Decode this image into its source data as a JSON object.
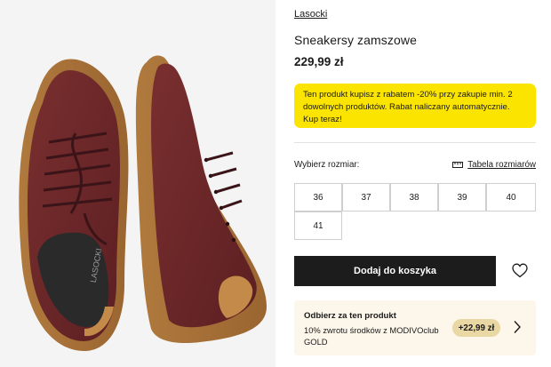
{
  "product": {
    "brand": "Lasocki",
    "name": "Sneakersy zamszowe",
    "price": "229,99 zł",
    "insole_logo": "LASOCKI"
  },
  "promo": {
    "text": "Ten produkt kupisz z rabatem -20% przy zakupie min. 2 dowolnych produktów. Rabat naliczany automatycznie. Kup teraz!",
    "color": "#fbe400"
  },
  "sizes": {
    "label": "Wybierz rozmiar:",
    "table_link": "Tabela rozmiarów",
    "options": [
      "36",
      "37",
      "38",
      "39",
      "40",
      "41"
    ]
  },
  "cart": {
    "add_label": "Dodaj do koszyka"
  },
  "icons": {
    "wishlist": "heart-icon",
    "size_table": "ruler-icon",
    "reward": "chevron-right-icon"
  },
  "reward": {
    "title": "Odbierz za ten produkt",
    "description": "10% zwrotu środków z MODIVOclub GOLD",
    "amount": "+22,99 zł",
    "badge_color": "#e9d7a4"
  }
}
